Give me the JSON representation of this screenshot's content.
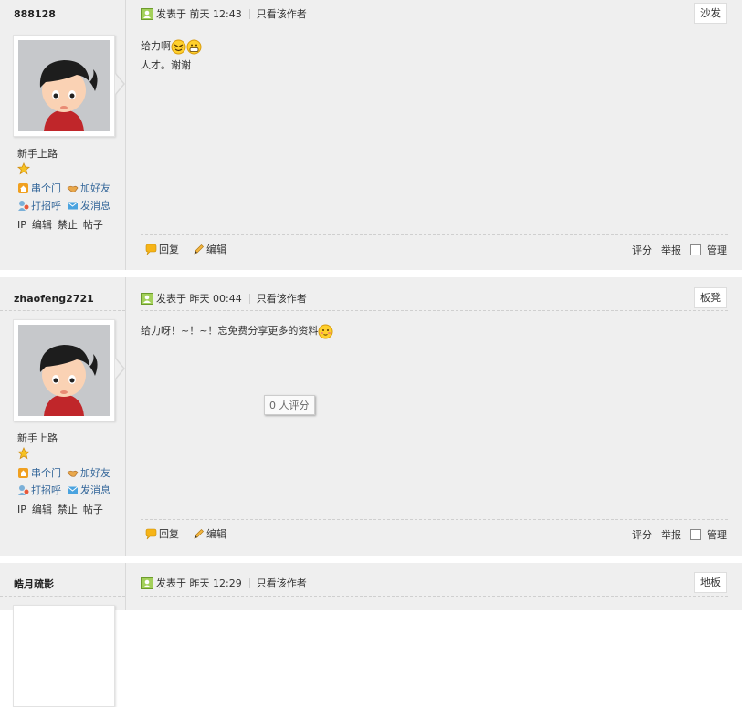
{
  "posts": [
    {
      "username": "888128",
      "rank": "新手上路",
      "links": {
        "visit": "串个门",
        "add_friend": "加好友",
        "greet": "打招呼",
        "message": "发消息"
      },
      "admin": {
        "ip": "IP",
        "edit": "编辑",
        "ban": "禁止",
        "posts": "帖子"
      },
      "posted_label": "发表于 前天 12:43",
      "author_only": "只看该作者",
      "floor": "沙发",
      "lines": [
        "给力啊",
        "人才。谢谢"
      ],
      "footer": {
        "reply": "回复",
        "edit": "编辑",
        "rate": "评分",
        "report": "举报",
        "manage": "管理"
      }
    },
    {
      "username": "zhaofeng2721",
      "rank": "新手上路",
      "links": {
        "visit": "串个门",
        "add_friend": "加好友",
        "greet": "打招呼",
        "message": "发消息"
      },
      "admin": {
        "ip": "IP",
        "edit": "编辑",
        "ban": "禁止",
        "posts": "帖子"
      },
      "posted_label": "发表于 昨天 00:44",
      "author_only": "只看该作者",
      "floor": "板凳",
      "lines": [
        "给力呀！~！~！忘免费分享更多的资料"
      ],
      "rating_tip": "0 人评分",
      "footer": {
        "reply": "回复",
        "edit": "编辑",
        "rate": "评分",
        "report": "举报",
        "manage": "管理"
      }
    },
    {
      "username": "皓月疏影",
      "posted_label": "发表于 昨天 12:29",
      "author_only": "只看该作者",
      "floor": "地板"
    }
  ],
  "colors": {
    "link": "#336699",
    "post_bg": "#efefef",
    "border": "#d9d9d9"
  }
}
